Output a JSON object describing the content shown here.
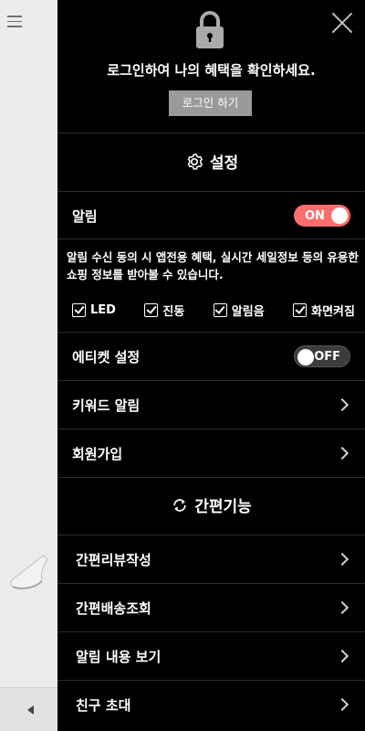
{
  "login": {
    "message": "로그인하여 나의 혜택을 확인하세요.",
    "button": "로그인 하기"
  },
  "settings": {
    "title": "설정"
  },
  "notification": {
    "label": "알림",
    "toggle": "ON",
    "description": "알림 수신 동의 시 앱전용 혜택, 실시간 세일정보 등의 유용한 쇼핑 정보를 받아볼 수 있습니다.",
    "options": [
      {
        "label": "LED",
        "checked": true
      },
      {
        "label": "진동",
        "checked": true
      },
      {
        "label": "알림음",
        "checked": true
      },
      {
        "label": "화면켜짐",
        "checked": true
      }
    ]
  },
  "etiquette": {
    "label": "에티켓 설정",
    "toggle": "OFF"
  },
  "keyword_alert": {
    "label": "키워드 알림"
  },
  "signup": {
    "label": "회원가입"
  },
  "quick": {
    "title": "간편기능",
    "items": [
      {
        "label": "간편리뷰작성"
      },
      {
        "label": "간편배송조회"
      },
      {
        "label": "알림 내용 보기"
      },
      {
        "label": "친구 초대"
      }
    ]
  },
  "colors": {
    "toggle_on": "#ff6e6e",
    "drawer_bg": "#000000",
    "login_button": "#9a9a9a"
  },
  "icons": [
    "lock-icon",
    "close-icon",
    "gear-icon",
    "refresh-icon",
    "chevron-right-icon",
    "hamburger-icon",
    "back-arrow-icon"
  ]
}
